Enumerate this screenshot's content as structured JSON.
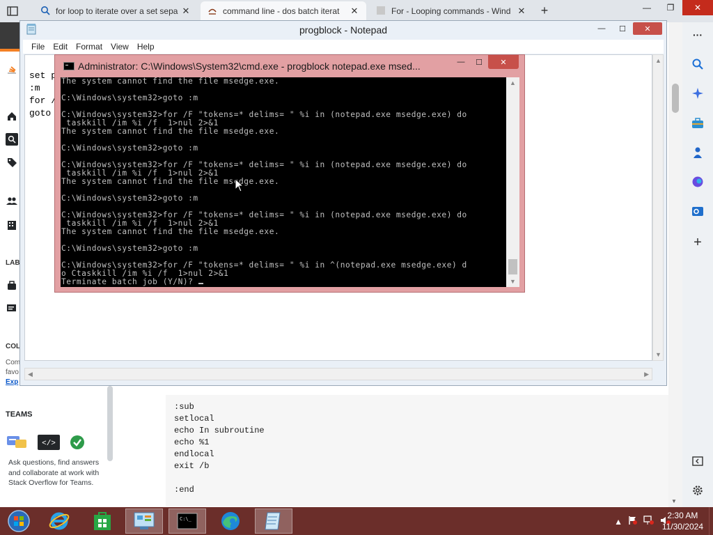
{
  "browser": {
    "tabs": [
      {
        "title": "for loop to iterate over a set sepa",
        "icon": "search-icon",
        "active": false
      },
      {
        "title": "command line - dos batch iterat",
        "icon": "stackoverflow-icon",
        "active": true
      },
      {
        "title": "For - Looping commands - Wind",
        "icon": "page-icon",
        "active": false
      }
    ],
    "new_tab_label": "+"
  },
  "notepad": {
    "title": "progblock - Notepad",
    "menu": [
      "File",
      "Edit",
      "Format",
      "View",
      "Help"
    ],
    "visible_lines": [
      "set p",
      ":m",
      "for /",
      "goto"
    ]
  },
  "cmd": {
    "title": "Administrator: C:\\Windows\\System32\\cmd.exe - progblock  notepad.exe msed...",
    "lines": [
      "The system cannot find the file msedge.exe.",
      "",
      "C:\\Windows\\system32>goto :m",
      "",
      "C:\\Windows\\system32>for /F \"tokens=* delims= \" %i in (notepad.exe msedge.exe) do",
      " taskkill /im %i /f  1>nul 2>&1",
      "The system cannot find the file msedge.exe.",
      "",
      "C:\\Windows\\system32>goto :m",
      "",
      "C:\\Windows\\system32>for /F \"tokens=* delims= \" %i in (notepad.exe msedge.exe) do",
      " taskkill /im %i /f  1>nul 2>&1",
      "The system cannot find the file msedge.exe.",
      "",
      "C:\\Windows\\system32>goto :m",
      "",
      "C:\\Windows\\system32>for /F \"tokens=* delims= \" %i in (notepad.exe msedge.exe) do",
      " taskkill /im %i /f  1>nul 2>&1",
      "The system cannot find the file msedge.exe.",
      "",
      "C:\\Windows\\system32>goto :m",
      "",
      "C:\\Windows\\system32>for /F \"tokens=* delims= \" %i in ^(notepad.exe msedge.exe) d",
      "o Ctaskkill /im %i /f  1>nul 2>&1",
      "Terminate batch job (Y/N)? "
    ]
  },
  "left_nav": {
    "labels_partial": [
      "LAB",
      "COL"
    ],
    "small_text": [
      "Com",
      "favo",
      "Exp"
    ]
  },
  "teams": {
    "label": "TEAMS",
    "description": "Ask questions, find answers and collaborate at work with Stack Overflow for Teams."
  },
  "code_block": {
    "lines": [
      ":sub",
      "setlocal",
      "echo In subroutine",
      "echo %1",
      "endlocal",
      "exit /b",
      "",
      ":end"
    ]
  },
  "taskbar": {
    "items": [
      "start",
      "internet-explorer",
      "store",
      "control-panel",
      "cmd",
      "edge",
      "notepad"
    ],
    "time": "2:30 AM",
    "date": "11/30/2024"
  },
  "colors": {
    "taskbar": "#6b2e2a",
    "cmd_frame": "#e2a0a3",
    "close_red": "#c42b1c",
    "so_orange": "#f48024"
  }
}
